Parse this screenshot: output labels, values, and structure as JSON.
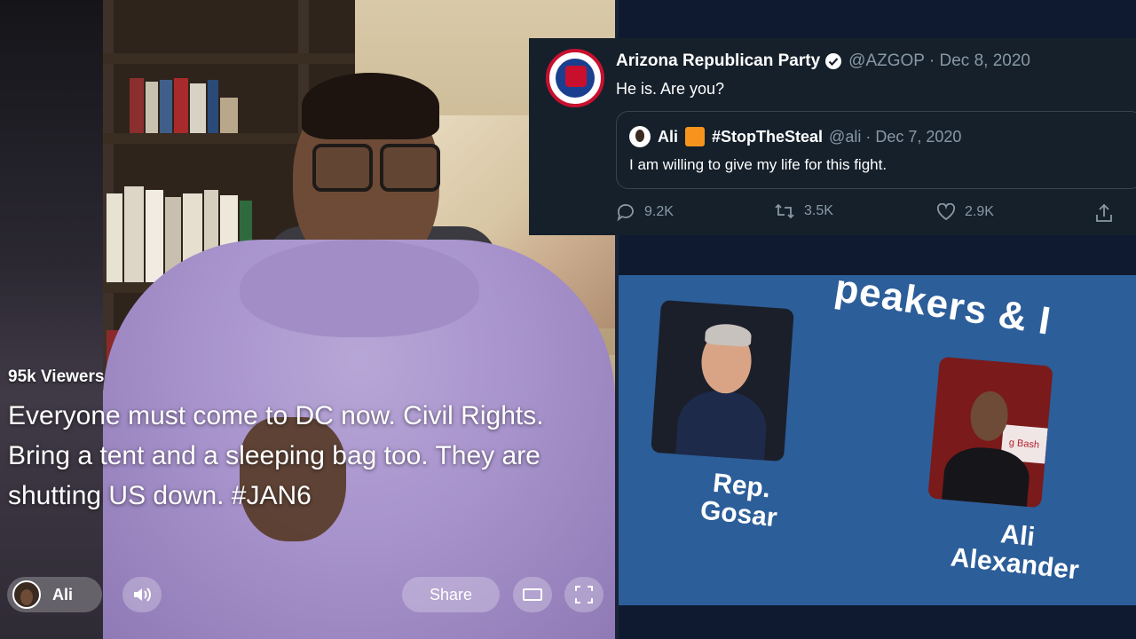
{
  "stream": {
    "viewers": "95k Viewers",
    "caption": "Everyone must come to DC now. Civil Rights. Bring a tent and a sleeping bag too. They are shutting US down. #JAN6",
    "host_name": "Ali",
    "share_label": "Share",
    "icons": [
      "volume-icon",
      "screen-icon",
      "fullscreen-icon"
    ]
  },
  "tweet": {
    "name": "Arizona Republican Party",
    "handle_date": "@AZGOP · Dec 8, 2020",
    "text": "He is. Are you?",
    "quote": {
      "name": "Ali",
      "tag": "#StopTheSteal",
      "handle_date": "@ali · Dec 7, 2020",
      "text": "I am willing to give my life for this fight."
    },
    "replies": "9.2K",
    "retweets": "3.5K",
    "likes": "2.9K",
    "colors": {
      "background": "#15202b",
      "verified": "#ffffff",
      "badge": "#f7941d"
    }
  },
  "slide": {
    "title": "peakers & I",
    "speaker1": "Rep. Gosar",
    "speaker2": "Ali Alexander",
    "sign_text": "g Bash",
    "background": "#2c5e99"
  }
}
